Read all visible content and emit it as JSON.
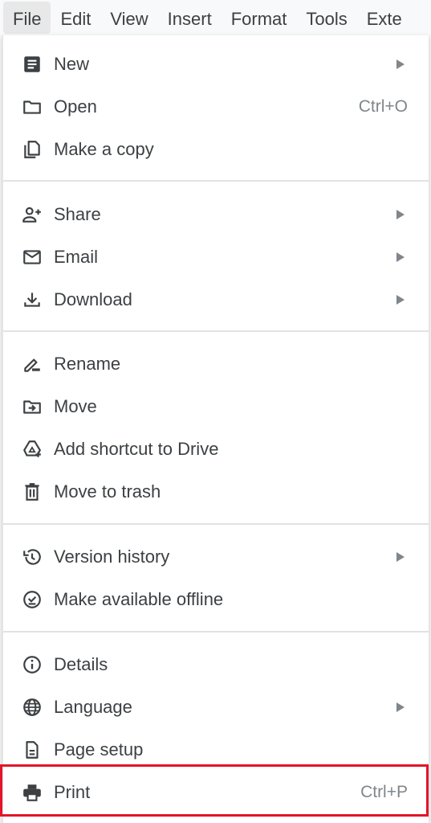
{
  "menubar": {
    "items": [
      "File",
      "Edit",
      "View",
      "Insert",
      "Format",
      "Tools",
      "Exte"
    ]
  },
  "menu": {
    "items": [
      {
        "label": "New",
        "icon": "new-document-icon",
        "submenu": true
      },
      {
        "label": "Open",
        "icon": "folder-icon",
        "shortcut": "Ctrl+O"
      },
      {
        "label": "Make a copy",
        "icon": "copy-icon"
      },
      {
        "label": "Share",
        "icon": "share-person-add-icon",
        "submenu": true
      },
      {
        "label": "Email",
        "icon": "email-icon",
        "submenu": true
      },
      {
        "label": "Download",
        "icon": "download-icon",
        "submenu": true
      },
      {
        "label": "Rename",
        "icon": "rename-pencil-icon"
      },
      {
        "label": "Move",
        "icon": "move-folder-icon"
      },
      {
        "label": "Add shortcut to Drive",
        "icon": "drive-shortcut-icon"
      },
      {
        "label": "Move to trash",
        "icon": "trash-icon"
      },
      {
        "label": "Version history",
        "icon": "history-icon",
        "submenu": true
      },
      {
        "label": "Make available offline",
        "icon": "offline-check-icon"
      },
      {
        "label": "Details",
        "icon": "info-icon"
      },
      {
        "label": "Language",
        "icon": "globe-icon",
        "submenu": true
      },
      {
        "label": "Page setup",
        "icon": "page-setup-icon"
      },
      {
        "label": "Print",
        "icon": "printer-icon",
        "shortcut": "Ctrl+P",
        "highlighted": true
      }
    ]
  },
  "colors": {
    "highlight_border": "#e4142a",
    "text": "#3c4043",
    "shortcut_text": "#80868b"
  }
}
